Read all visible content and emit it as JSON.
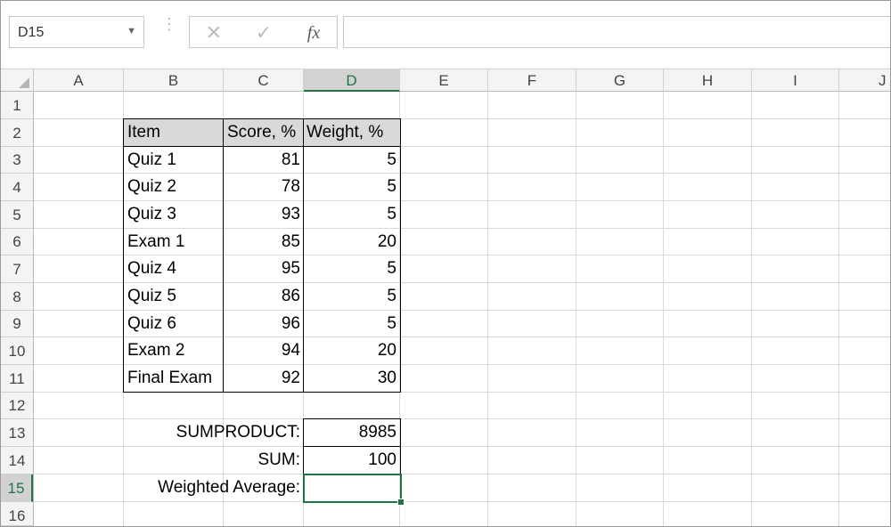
{
  "name_box": {
    "value": "D15"
  },
  "formula_bar": {
    "cancel_icon": "✕",
    "enter_icon": "✓",
    "fx_label": "fx",
    "formula": ""
  },
  "columns": [
    "A",
    "B",
    "C",
    "D",
    "E",
    "F",
    "G",
    "H",
    "I",
    "J"
  ],
  "rows": [
    "1",
    "2",
    "3",
    "4",
    "5",
    "6",
    "7",
    "8",
    "9",
    "10",
    "11",
    "12",
    "13",
    "14",
    "15",
    "16"
  ],
  "selected_cell": {
    "column": "D",
    "row": "15"
  },
  "table": {
    "headers": {
      "item": "Item",
      "score": "Score, %",
      "weight": "Weight, %"
    },
    "rows": [
      {
        "item": "Quiz 1",
        "score": "81",
        "weight": "5"
      },
      {
        "item": "Quiz 2",
        "score": "78",
        "weight": "5"
      },
      {
        "item": "Quiz 3",
        "score": "93",
        "weight": "5"
      },
      {
        "item": "Exam 1",
        "score": "85",
        "weight": "20"
      },
      {
        "item": "Quiz 4",
        "score": "95",
        "weight": "5"
      },
      {
        "item": "Quiz 5",
        "score": "86",
        "weight": "5"
      },
      {
        "item": "Quiz 6",
        "score": "96",
        "weight": "5"
      },
      {
        "item": "Exam 2",
        "score": "94",
        "weight": "20"
      },
      {
        "item": "Final Exam",
        "score": "92",
        "weight": "30"
      }
    ]
  },
  "summary": {
    "sumproduct_label": "SUMPRODUCT:",
    "sumproduct_value": "8985",
    "sum_label": "SUM:",
    "sum_value": "100",
    "weighted_label": "Weighted Average:",
    "weighted_value": ""
  },
  "colors": {
    "accent_green": "#217346",
    "header_fill": "#d9d9d9"
  }
}
